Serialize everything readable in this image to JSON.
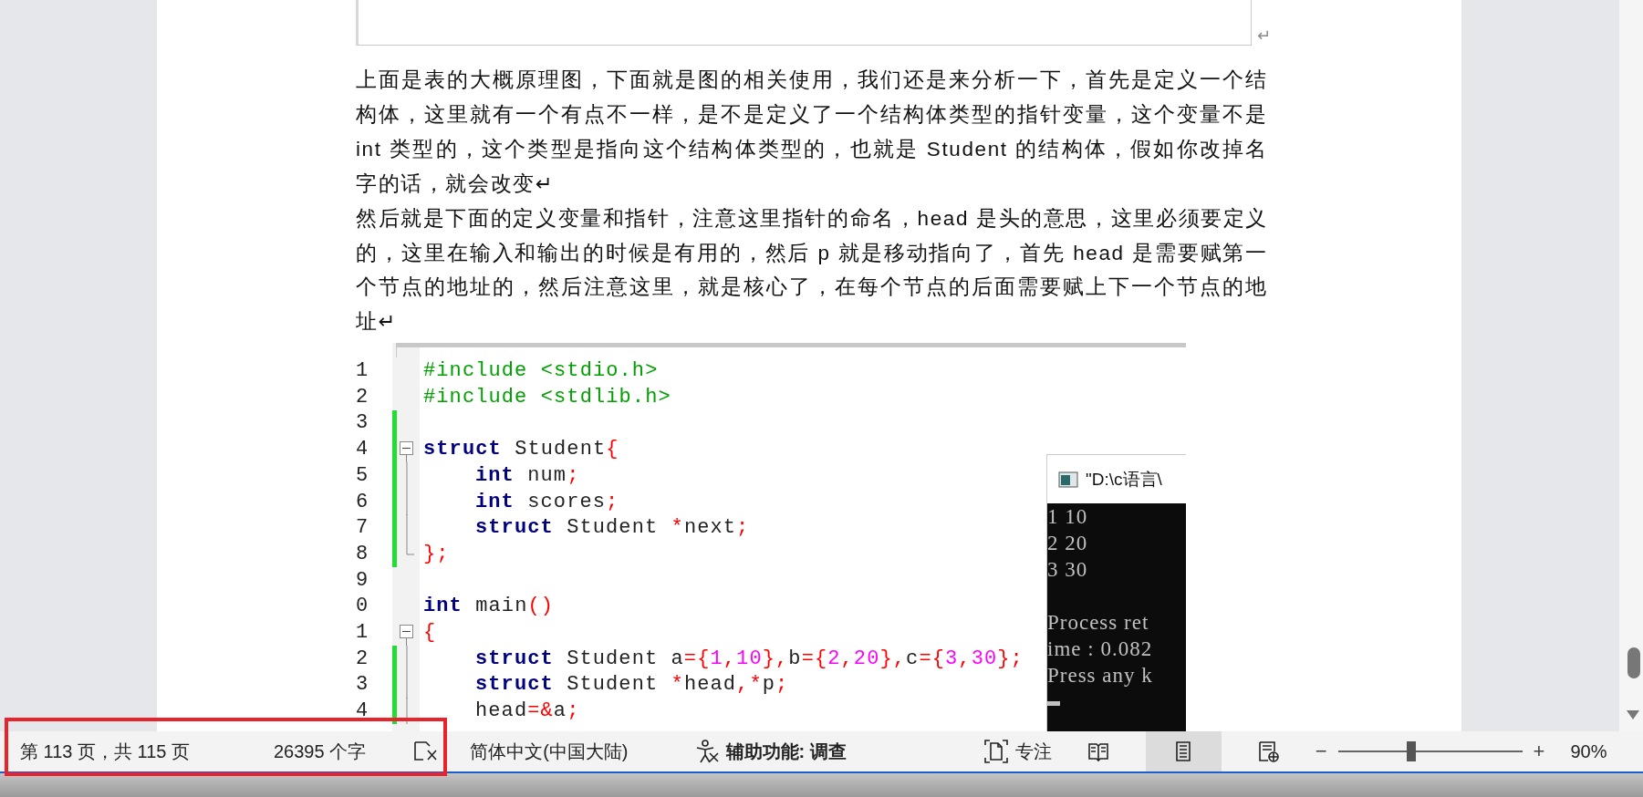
{
  "document": {
    "textbox_mark": "↵",
    "paragraphs": [
      "上面是表的大概原理图，下面就是图的相关使用，我们还是来分析一下，首先是定义一个结构体，这里就有一个有点不一样，是不是定义了一个结构体类型的指针变量，这个变量不是 int 类型的，这个类型是指向这个结构体类型的，也就是 Student 的结构体，假如你改掉名字的话，就会改变↵",
      "然后就是下面的定义变量和指针，注意这里指针的命名，head 是头的意思，这里必须要定义的，这里在输入和输出的时候是有用的，然后 p 就是移动指向了，首先 head 是需要赋第一个节点的地址的，然后注意这里，就是核心了，在每个节点的后面需要赋上下一个节点的地址↵"
    ]
  },
  "code": {
    "lines": [
      {
        "number": "1",
        "changed": false,
        "indented": false,
        "tokens": [
          {
            "kind": "preproc",
            "text": "#include <stdio.h>"
          }
        ]
      },
      {
        "number": "2",
        "changed": false,
        "indented": false,
        "tokens": [
          {
            "kind": "preproc",
            "text": "#include <stdlib.h>"
          }
        ]
      },
      {
        "number": "3",
        "changed": true
      },
      {
        "number": "4",
        "changed": true,
        "indented": false,
        "fold": {
          "kind": "open"
        },
        "tokens": [
          {
            "kind": "keyword",
            "text": "struct"
          },
          {
            "kind": "plain",
            "text": " Student"
          },
          {
            "kind": "operator",
            "text": "{"
          }
        ]
      },
      {
        "number": "5",
        "changed": true,
        "indented": true,
        "fold": {
          "kind": "line"
        },
        "tokens": [
          {
            "kind": "keyword",
            "text": "int"
          },
          {
            "kind": "plain",
            "text": " num"
          },
          {
            "kind": "operator",
            "text": ";"
          }
        ]
      },
      {
        "number": "6",
        "changed": true,
        "indented": true,
        "fold": {
          "kind": "line"
        },
        "tokens": [
          {
            "kind": "keyword",
            "text": "int"
          },
          {
            "kind": "plain",
            "text": " scores"
          },
          {
            "kind": "operator",
            "text": ";"
          }
        ]
      },
      {
        "number": "7",
        "changed": true,
        "indented": true,
        "fold": {
          "kind": "line"
        },
        "tokens": [
          {
            "kind": "keyword",
            "text": "struct"
          },
          {
            "kind": "plain",
            "text": " Student "
          },
          {
            "kind": "operator",
            "text": "*"
          },
          {
            "kind": "plain",
            "text": "next"
          },
          {
            "kind": "operator",
            "text": ";"
          }
        ]
      },
      {
        "number": "8",
        "changed": true,
        "indented": false,
        "fold": {
          "kind": "end"
        },
        "tokens": [
          {
            "kind": "operator",
            "text": "};"
          }
        ]
      },
      {
        "number": "9",
        "changed": false
      },
      {
        "number": "0",
        "changed": false,
        "indented": false,
        "tokens": [
          {
            "kind": "keyword",
            "text": "int"
          },
          {
            "kind": "plain",
            "text": " main"
          },
          {
            "kind": "operator",
            "text": "()"
          }
        ]
      },
      {
        "number": "1",
        "changed": false,
        "indented": false,
        "fold": {
          "kind": "open"
        },
        "tokens": [
          {
            "kind": "operator",
            "text": "{"
          }
        ]
      },
      {
        "number": "2",
        "changed": true,
        "indented": true,
        "fold": {
          "kind": "line"
        },
        "tokens": [
          {
            "kind": "keyword",
            "text": "struct"
          },
          {
            "kind": "plain",
            "text": " Student a"
          },
          {
            "kind": "operator",
            "text": "={"
          },
          {
            "kind": "number",
            "text": "1"
          },
          {
            "kind": "operator",
            "text": ","
          },
          {
            "kind": "number",
            "text": "10"
          },
          {
            "kind": "operator",
            "text": "},"
          },
          {
            "kind": "plain",
            "text": "b"
          },
          {
            "kind": "operator",
            "text": "={"
          },
          {
            "kind": "number",
            "text": "2"
          },
          {
            "kind": "operator",
            "text": ","
          },
          {
            "kind": "number",
            "text": "20"
          },
          {
            "kind": "operator",
            "text": "},"
          },
          {
            "kind": "plain",
            "text": "c"
          },
          {
            "kind": "operator",
            "text": "={"
          },
          {
            "kind": "number",
            "text": "3"
          },
          {
            "kind": "operator",
            "text": ","
          },
          {
            "kind": "number",
            "text": "30"
          },
          {
            "kind": "operator",
            "text": "};"
          }
        ]
      },
      {
        "number": "3",
        "changed": true,
        "indented": true,
        "fold": {
          "kind": "line"
        },
        "tokens": [
          {
            "kind": "keyword",
            "text": "struct"
          },
          {
            "kind": "plain",
            "text": " Student "
          },
          {
            "kind": "operator",
            "text": "*"
          },
          {
            "kind": "plain",
            "text": "head"
          },
          {
            "kind": "operator",
            "text": ",*"
          },
          {
            "kind": "plain",
            "text": "p"
          },
          {
            "kind": "operator",
            "text": ";"
          }
        ]
      },
      {
        "number": "4",
        "changed": true,
        "indented": true,
        "fold": {
          "kind": "line"
        },
        "tokens": [
          {
            "kind": "plain",
            "text": "head"
          },
          {
            "kind": "operator",
            "text": "=&"
          },
          {
            "kind": "plain",
            "text": "a"
          },
          {
            "kind": "operator",
            "text": ";"
          }
        ]
      }
    ],
    "console": {
      "title": "\"D:\\c语言\\",
      "lines": [
        {
          "text": "1 10",
          "blank_before": false
        },
        {
          "text": "2 20",
          "blank_before": false
        },
        {
          "text": "3 30",
          "blank_before": false
        },
        {
          "text": "Process ret",
          "blank_before": true
        },
        {
          "text": "ime : 0.082",
          "blank_before": false
        },
        {
          "text": "Press any k",
          "blank_before": false
        }
      ]
    }
  },
  "status_bar": {
    "page": "第 113 页，共 115 页",
    "words": "26395 个字",
    "language": "简体中文(中国大陆)",
    "accessibility": "辅助功能: 调查",
    "focus": "专注",
    "views": [
      {
        "kind": "read",
        "selected": false
      },
      {
        "kind": "print",
        "selected": true
      },
      {
        "kind": "web",
        "selected": false
      }
    ],
    "zoom": {
      "minus": "−",
      "plus": "+",
      "level": 0.4,
      "reading": "90%"
    }
  }
}
